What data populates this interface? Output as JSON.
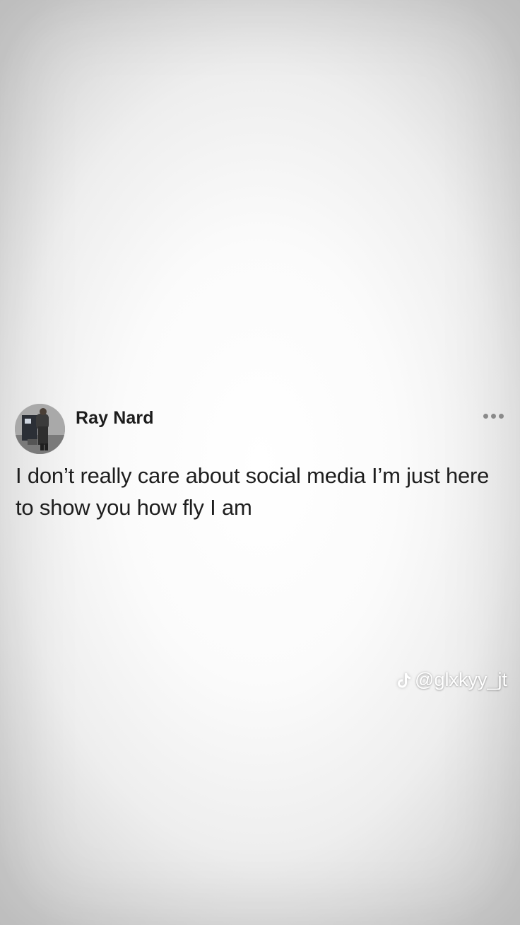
{
  "post": {
    "author_name": "Ray Nard",
    "text": "I don’t really care about social media I’m just here to show you how fly I am",
    "avatar_icon": "person-photo-avatar",
    "more_icon": "more-horizontal-icon"
  },
  "watermark": {
    "icon": "tiktok-logo-icon",
    "handle": "@glxkyy_jt"
  },
  "colors": {
    "background_center": "#ffffff",
    "background_edge": "#cfcfcf",
    "text": "#1e1e1e",
    "dots": "#8a8a8a",
    "watermark": "#ffffff"
  }
}
